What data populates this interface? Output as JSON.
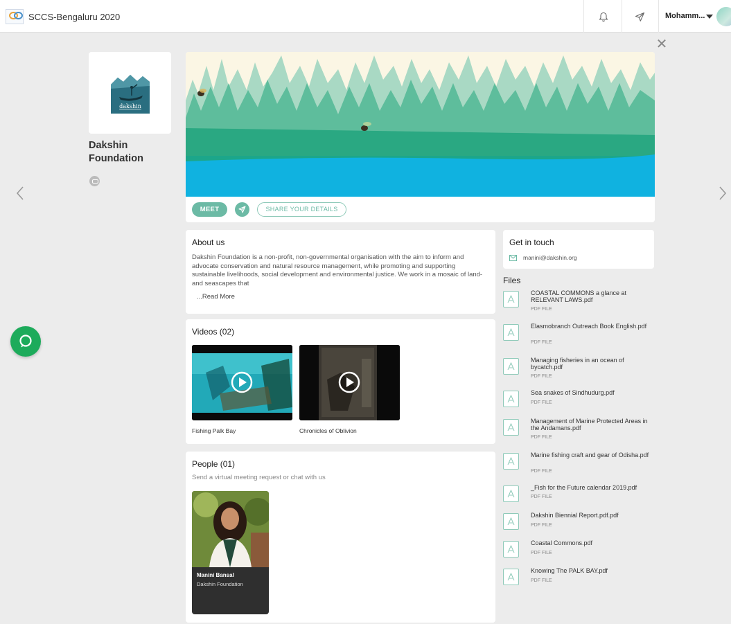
{
  "header": {
    "app_title": "SCCS-Bengaluru 2020",
    "user_name": "Mohamm..."
  },
  "org": {
    "name": "Dakshin Foundation",
    "logo_text": "dakshin"
  },
  "actions": {
    "meet_label": "MEET",
    "share_label": "SHARE YOUR DETAILS"
  },
  "about": {
    "title": "About us",
    "text": "Dakshin Foundation is a non-profit, non-governmental organisation with the aim to inform and advocate conservation and natural resource management, while promoting and supporting sustainable livelihoods, social development and environmental justice. We work in a mosaic of land- and seascapes that",
    "read_more": "...Read More"
  },
  "contact": {
    "title": "Get in touch",
    "email": "manini@dakshin.org"
  },
  "videos": {
    "title": "Videos (02)",
    "items": [
      {
        "label": "Fishing Palk Bay"
      },
      {
        "label": "Chronicles of Oblivion"
      }
    ]
  },
  "people": {
    "title": "People (01)",
    "subtitle": "Send a virtual meeting request or chat with us",
    "items": [
      {
        "name": "Manini Bansal",
        "org": "Dakshin Foundation"
      }
    ]
  },
  "files": {
    "title": "Files",
    "items": [
      {
        "name": "COASTAL COMMONS a glance at RELEVANT LAWS.pdf",
        "type": "PDF FILE"
      },
      {
        "name": "Elasmobranch Outreach Book English.pdf",
        "type": "PDF FILE"
      },
      {
        "name": "Managing fisheries in an ocean of bycatch.pdf",
        "type": "PDF FILE"
      },
      {
        "name": "Sea snakes of Sindhudurg.pdf",
        "type": "PDF FILE"
      },
      {
        "name": "Management of Marine Protected Areas in the Andamans.pdf",
        "type": "PDF FILE"
      },
      {
        "name": "Marine fishing craft and gear of Odisha.pdf",
        "type": "PDF FILE"
      },
      {
        "name": "_Fish for the Future calendar 2019.pdf",
        "type": "PDF FILE"
      },
      {
        "name": "Dakshin Biennial Report.pdf.pdf",
        "type": "PDF FILE"
      },
      {
        "name": "Coastal Commons.pdf",
        "type": "PDF FILE"
      },
      {
        "name": "Knowing The PALK BAY.pdf",
        "type": "PDF FILE"
      }
    ]
  },
  "colors": {
    "accent": "#6cbaa5",
    "chat": "#1dab5b",
    "background": "#ececec"
  }
}
